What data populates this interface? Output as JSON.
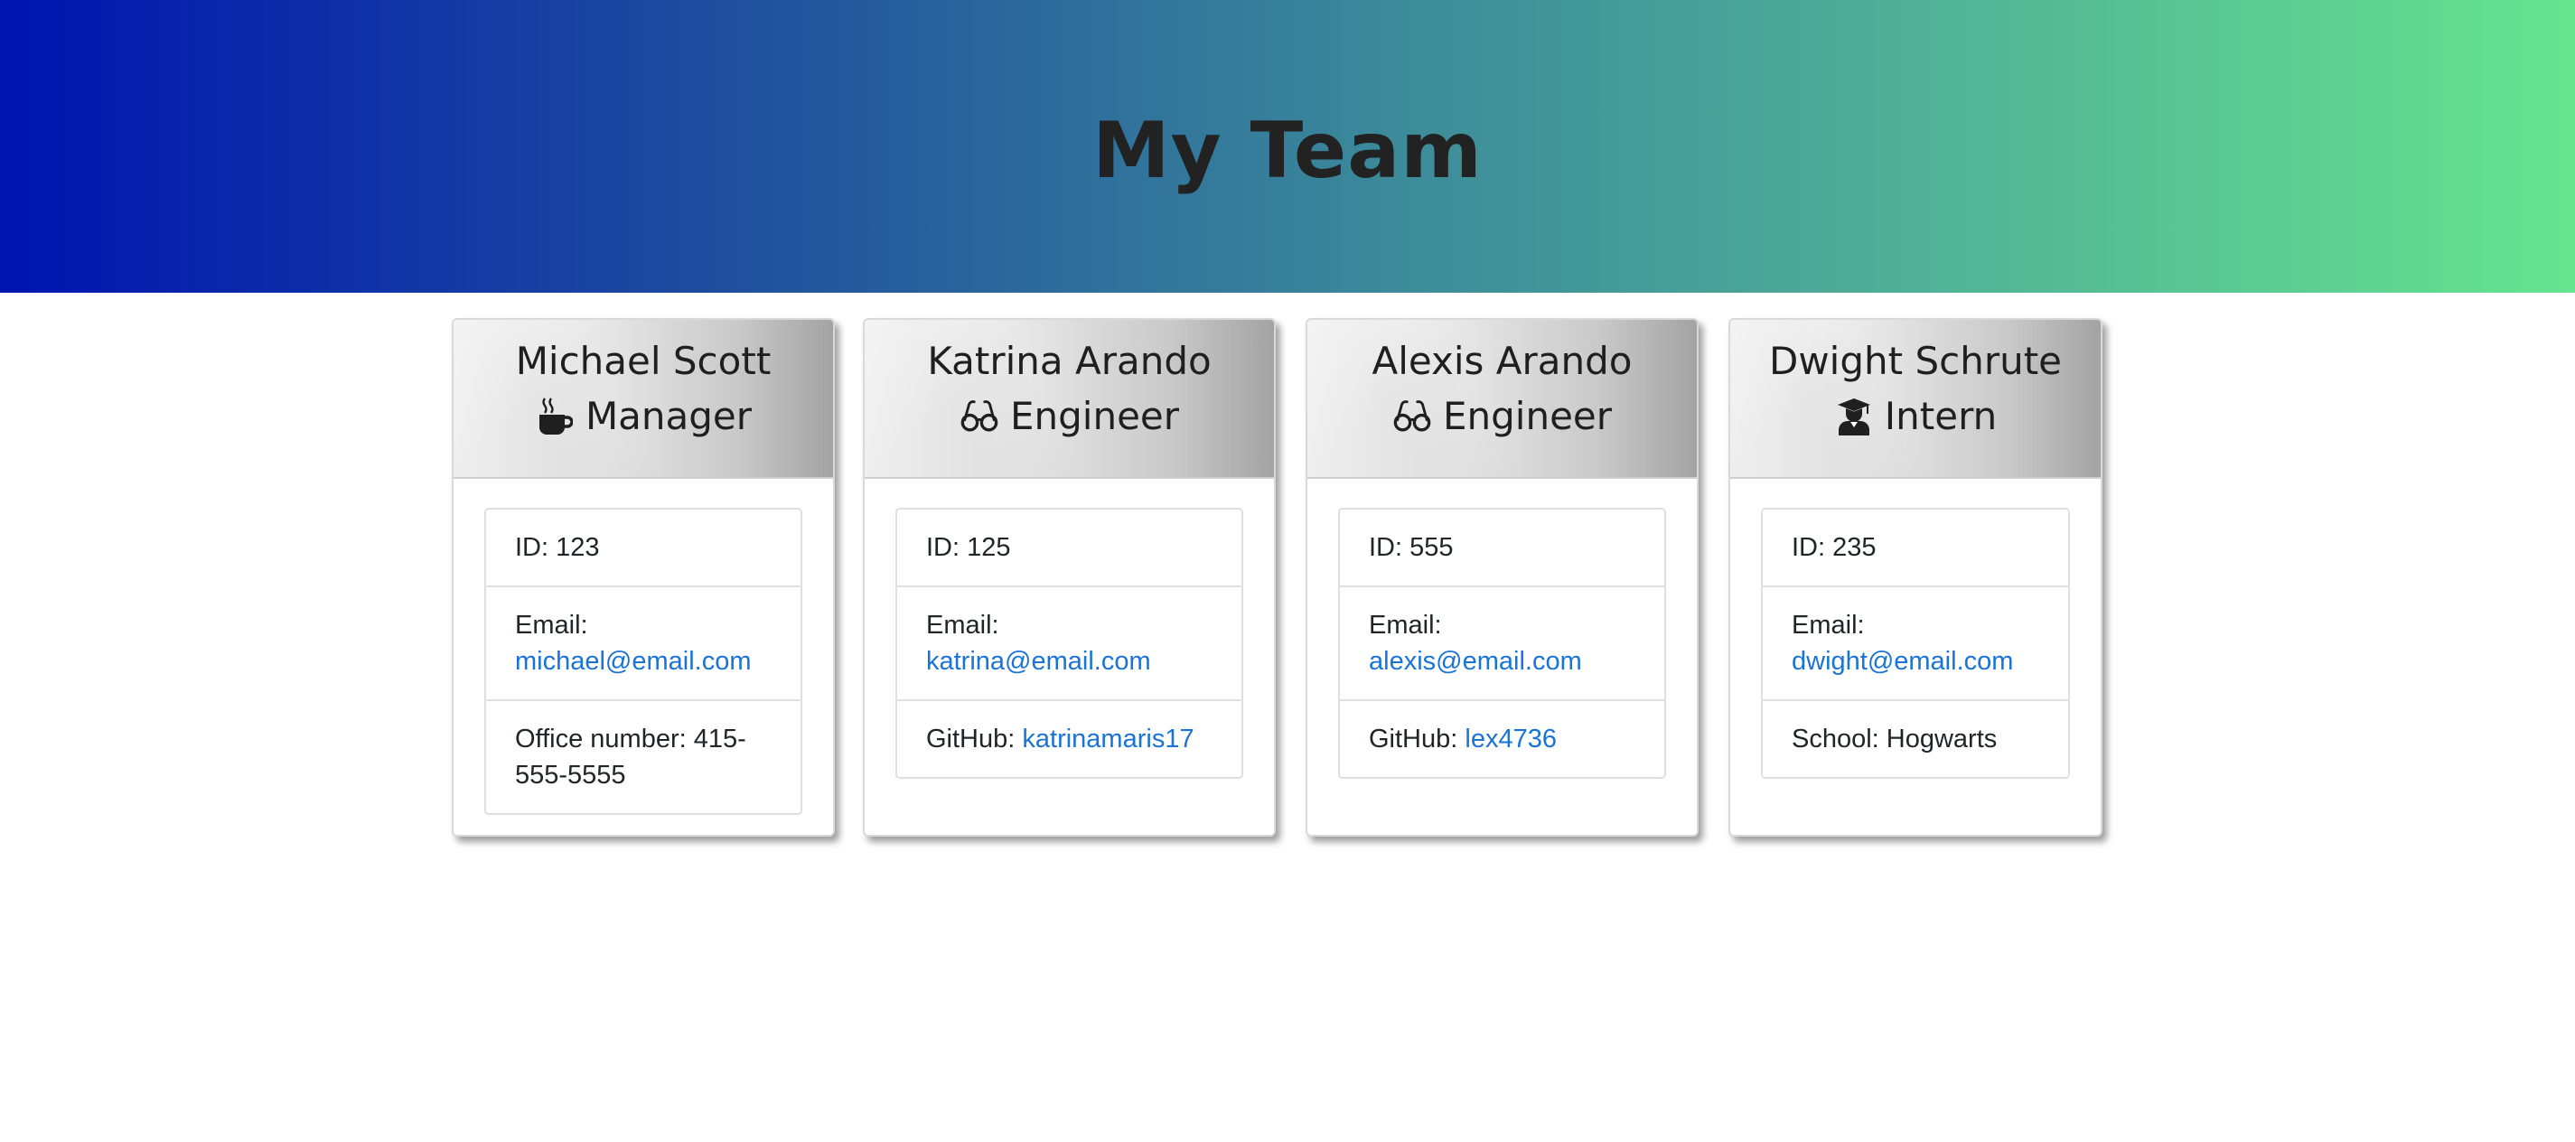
{
  "header": {
    "title": "My Team"
  },
  "colors": {
    "gradient_start": "#0014b0",
    "gradient_end": "#66e48f",
    "link": "#1a73d6"
  },
  "cards": [
    {
      "name": "Michael Scott",
      "role": "Manager",
      "icon": "coffee-icon",
      "id_label": "ID: 123",
      "email_label": "Email:",
      "email": "michael@email.com",
      "extra_prefix": "Office number: 415-",
      "extra_line2": "555-5555"
    },
    {
      "name": "Katrina Arando",
      "role": "Engineer",
      "icon": "glasses-icon",
      "id_label": "ID: 125",
      "email_label": "Email:",
      "email": "katrina@email.com",
      "extra_label": "GitHub:",
      "extra_value": "katrinamaris17"
    },
    {
      "name": "Alexis Arando",
      "role": "Engineer",
      "icon": "glasses-icon",
      "id_label": "ID: 555",
      "email_label": "Email:",
      "email": "alexis@email.com",
      "extra_label": "GitHub:",
      "extra_value": "lex4736"
    },
    {
      "name": "Dwight Schrute",
      "role": "Intern",
      "icon": "graduate-icon",
      "id_label": "ID: 235",
      "email_label": "Email:",
      "email": "dwight@email.com",
      "extra_text": "School: Hogwarts"
    }
  ]
}
